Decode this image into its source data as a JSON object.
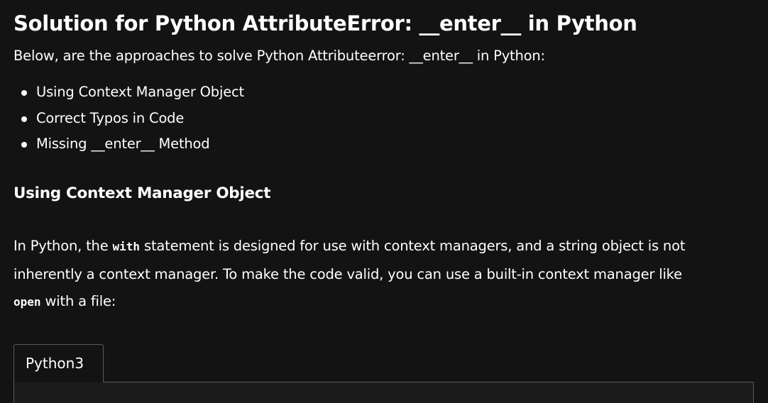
{
  "article": {
    "title": "Solution for Python AttributeError: __enter__ in Python",
    "intro": "Below, are the approaches to solve Python Attributeerror: __enter__ in Python:",
    "approaches": [
      "Using Context Manager Object",
      "Correct Typos in Code",
      "Missing __enter__ Method"
    ],
    "section_heading": "Using Context Manager Object",
    "paragraph": {
      "part1": "In Python, the ",
      "code1": "with",
      "part2": " statement is designed for use with context managers, and a string object is not",
      "part3": "inherently a context manager. To make the code valid, you can use a built-in context manager like",
      "code2": "open",
      "part4": " with a file:"
    }
  },
  "code_block": {
    "tabs": [
      "Python3"
    ]
  },
  "colors": {
    "background": "#131313",
    "text": "#ffffff",
    "tab_border": "#5a5a5a"
  }
}
